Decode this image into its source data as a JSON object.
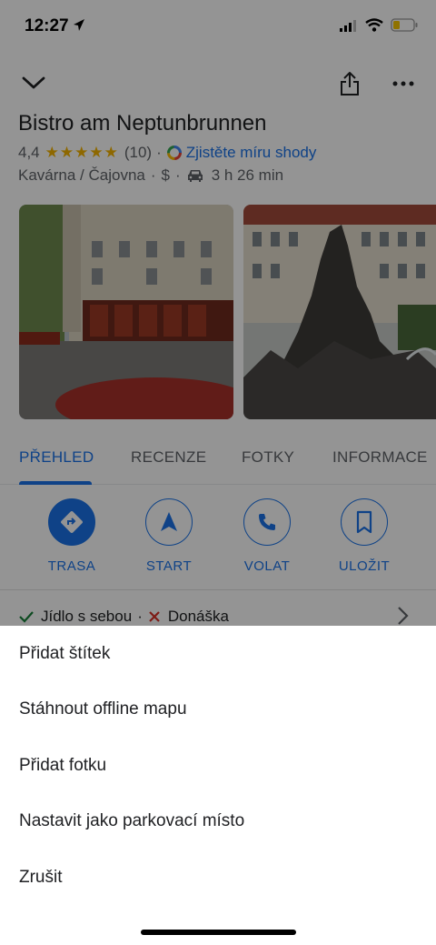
{
  "status_bar": {
    "time": "12:27"
  },
  "place": {
    "title": "Bistro am Neptunbrunnen",
    "rating": "4,4",
    "stars": "★★★★★",
    "reviews": "(10)",
    "match_link": "Zjistěte míru shody",
    "category": "Kavárna / Čajovna",
    "price": "$",
    "drive_time": "3 h 26 min"
  },
  "tabs": [
    {
      "label": "PŘEHLED",
      "active": true
    },
    {
      "label": "RECENZE",
      "active": false
    },
    {
      "label": "FOTKY",
      "active": false
    },
    {
      "label": "INFORMACE",
      "active": false
    }
  ],
  "actions": [
    {
      "label": "TRASA",
      "icon": "directions-icon"
    },
    {
      "label": "START",
      "icon": "navigation-icon"
    },
    {
      "label": "VOLAT",
      "icon": "phone-icon"
    },
    {
      "label": "ULOŽIT",
      "icon": "bookmark-icon"
    }
  ],
  "amenities": {
    "takeaway": "Jídlo s sebou",
    "separator": "·",
    "delivery": "Donáška"
  },
  "sheet": {
    "items": [
      "Přidat štítek",
      "Stáhnout offline mapu",
      "Přidat fotku",
      "Nastavit jako parkovací místo",
      "Zrušit"
    ]
  },
  "colors": {
    "accent": "#1a73e8",
    "star": "#f4b400",
    "check": "#188038",
    "cross": "#d93025"
  }
}
